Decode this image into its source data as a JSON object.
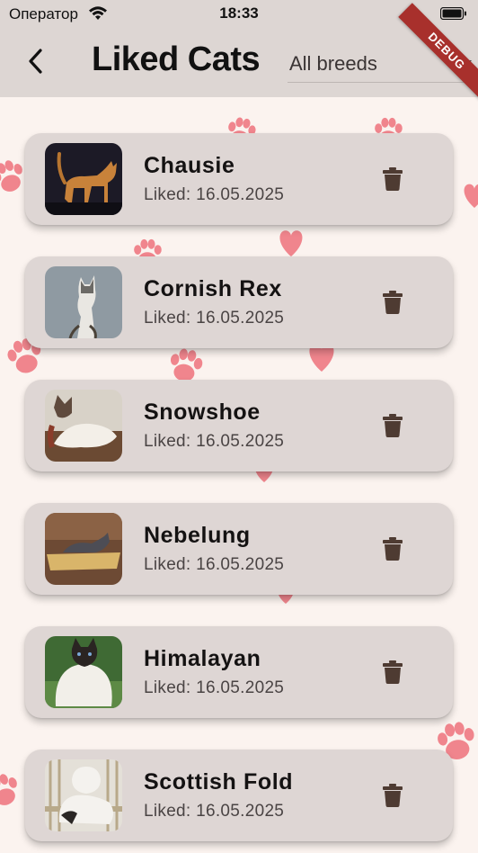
{
  "status_bar": {
    "carrier": "Оператор",
    "time": "18:33"
  },
  "app_bar": {
    "title": "Liked Cats",
    "breed_filter": "All breeds",
    "debug_label": "DEBUG"
  },
  "colors": {
    "background": "#fbf3ef",
    "bar": "#ddd6d3",
    "card": "#ded6d4",
    "accent": "#e8707a",
    "icon": "#4e3b32"
  },
  "icons": {
    "back": "chevron-left-icon",
    "dropdown": "caret-down-icon",
    "delete": "trash-icon",
    "wifi": "wifi-icon",
    "battery": "battery-icon",
    "background": "paw-icon"
  },
  "liked_cats": [
    {
      "breed": "Chausie",
      "liked": "Liked: 16.05.2025"
    },
    {
      "breed": "Cornish Rex",
      "liked": "Liked: 16.05.2025"
    },
    {
      "breed": "Snowshoe",
      "liked": "Liked: 16.05.2025"
    },
    {
      "breed": "Nebelung",
      "liked": "Liked: 16.05.2025"
    },
    {
      "breed": "Himalayan",
      "liked": "Liked: 16.05.2025"
    },
    {
      "breed": "Scottish Fold",
      "liked": "Liked: 16.05.2025"
    }
  ]
}
